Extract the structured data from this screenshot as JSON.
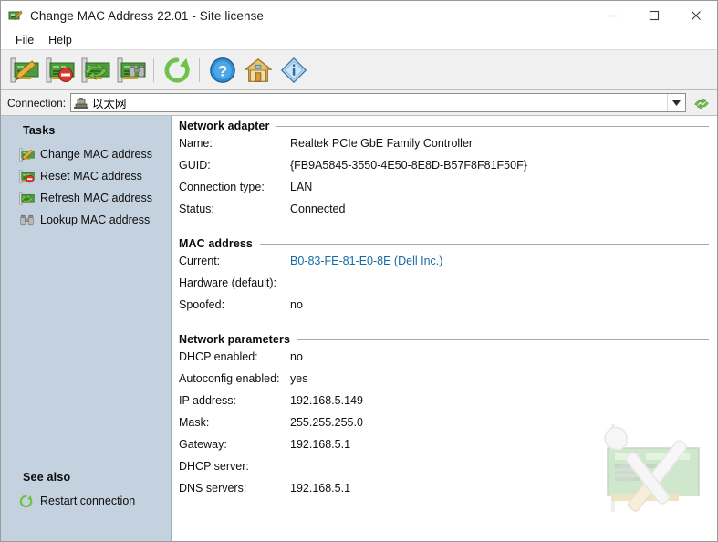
{
  "window": {
    "title": "Change MAC Address 22.01 - Site license",
    "app_icon": "network-card-icon",
    "controls": {
      "minimize": "minimize-icon",
      "maximize": "maximize-icon",
      "close": "close-icon"
    }
  },
  "menubar": {
    "items": [
      {
        "label": "File"
      },
      {
        "label": "Help"
      }
    ]
  },
  "toolbar": {
    "buttons": [
      {
        "name": "change-mac-address",
        "icon": "network-card-pencil-icon",
        "tooltip": "Change MAC address"
      },
      {
        "name": "reset-mac-address",
        "icon": "network-card-stop-icon",
        "tooltip": "Reset MAC address"
      },
      {
        "name": "refresh-mac-address",
        "icon": "network-card-refresh-icon",
        "tooltip": "Refresh MAC address"
      },
      {
        "name": "lookup-mac-address",
        "icon": "network-card-binoculars-icon",
        "tooltip": "Lookup MAC address"
      },
      {
        "name": "restart-connection",
        "icon": "green-refresh-icon",
        "tooltip": "Restart connection"
      },
      {
        "name": "help",
        "icon": "blue-question-icon",
        "tooltip": "Help"
      },
      {
        "name": "home",
        "icon": "house-icon",
        "tooltip": "Home page"
      },
      {
        "name": "about",
        "icon": "blue-info-diamond-icon",
        "tooltip": "About"
      }
    ]
  },
  "connection": {
    "label": "Connection:",
    "value": "以太网",
    "icon": "network-card-icon",
    "dropdown_arrow": "chevron-down-icon",
    "refresh_icon": "green-refresh-circular-icon"
  },
  "sidebar": {
    "tasks_heading": "Tasks",
    "tasks": [
      {
        "label": "Change MAC address",
        "icon": "network-card-pencil-icon"
      },
      {
        "label": "Reset MAC address",
        "icon": "network-card-stop-icon"
      },
      {
        "label": "Refresh MAC address",
        "icon": "network-card-refresh-icon"
      },
      {
        "label": "Lookup MAC address",
        "icon": "binoculars-icon"
      }
    ],
    "see_also_heading": "See also",
    "see_also": [
      {
        "label": "Restart connection",
        "icon": "green-refresh-icon"
      }
    ]
  },
  "main": {
    "sections": [
      {
        "title": "Network adapter",
        "rows": [
          {
            "label": "Name:",
            "value": "Realtek PCIe GbE Family Controller",
            "link": false
          },
          {
            "label": "GUID:",
            "value": "{FB9A5845-3550-4E50-8E8D-B57F8F81F50F}",
            "link": false
          },
          {
            "label": "Connection type:",
            "value": "LAN",
            "link": false
          },
          {
            "label": "Status:",
            "value": "Connected",
            "link": false
          }
        ]
      },
      {
        "title": "MAC address",
        "rows": [
          {
            "label": "Current:",
            "value": "B0-83-FE-81-E0-8E (Dell Inc.)",
            "link": true
          },
          {
            "label": "Hardware (default):",
            "value": "",
            "link": false
          },
          {
            "label": "Spoofed:",
            "value": "no",
            "link": false
          }
        ]
      },
      {
        "title": "Network parameters",
        "rows": [
          {
            "label": "DHCP enabled:",
            "value": "no",
            "link": false
          },
          {
            "label": "Autoconfig enabled:",
            "value": "yes",
            "link": false
          },
          {
            "label": "IP address:",
            "value": "192.168.5.149",
            "link": false
          },
          {
            "label": "Mask:",
            "value": "255.255.255.0",
            "link": false
          },
          {
            "label": "Gateway:",
            "value": "192.168.5.1",
            "link": false
          },
          {
            "label": "DHCP server:",
            "value": "",
            "link": false
          },
          {
            "label": "DNS servers:",
            "value": "192.168.5.1",
            "link": false
          }
        ]
      }
    ],
    "watermark_icon": "network-card-tools-watermark"
  },
  "colors": {
    "sidebar_bg": "#c4d1de",
    "toolbar_bg": "#f0f0f0",
    "link": "#1569a5",
    "rule": "#a9a9a9"
  }
}
